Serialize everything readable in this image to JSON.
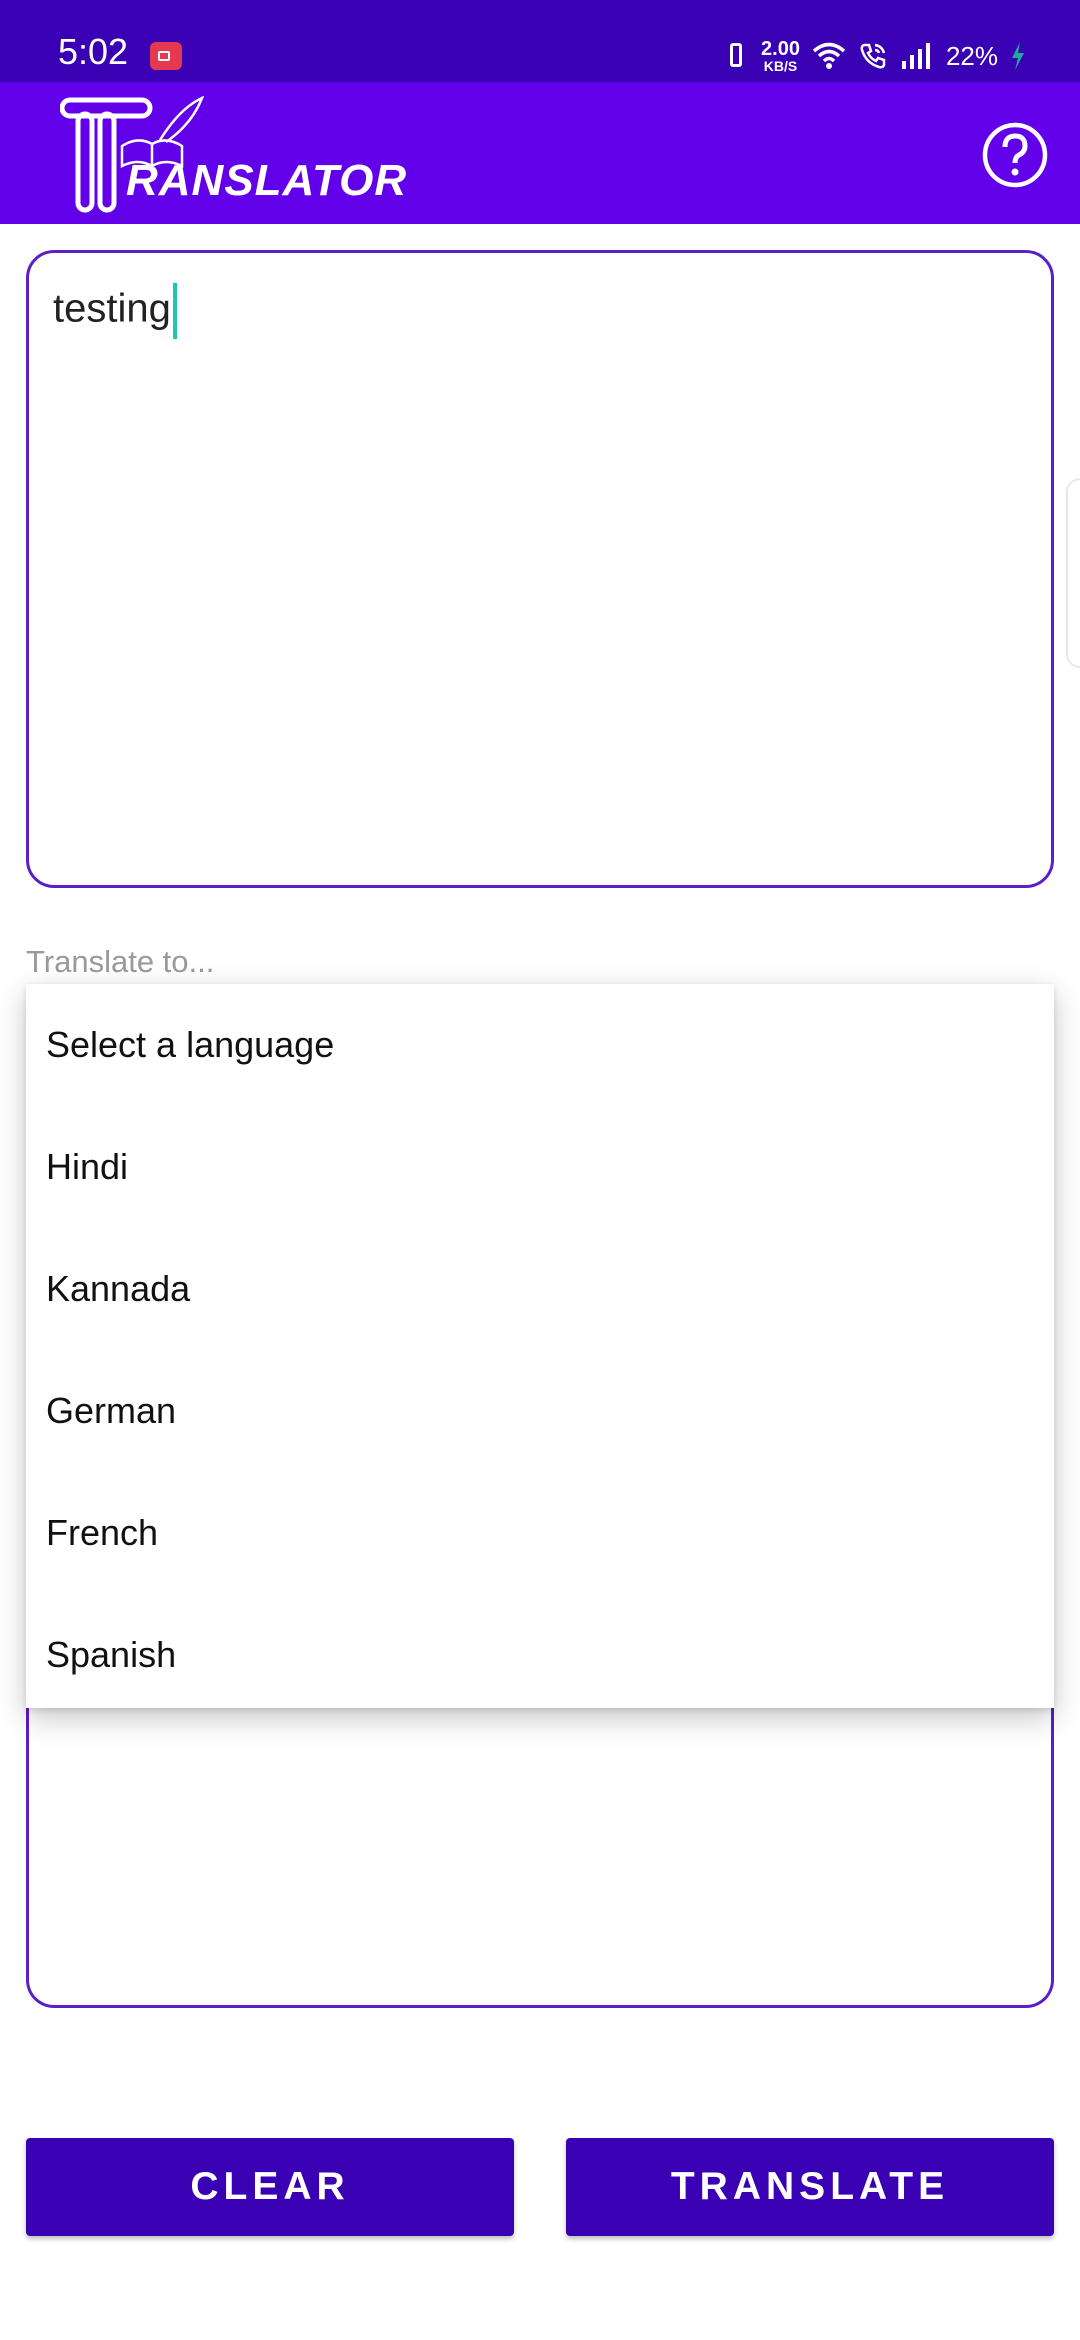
{
  "status_bar": {
    "time": "5:02",
    "net_speed_value": "2.00",
    "net_speed_unit": "KB/S",
    "battery": "22%",
    "icons": [
      "screen-record-icon",
      "vibrate-icon",
      "wifi-icon",
      "wifi-calling-icon",
      "signal-icon",
      "charging-icon"
    ]
  },
  "app_bar": {
    "logo_text": "RANSLATOR",
    "help_icon": "help-circle-icon"
  },
  "input": {
    "value": "testing"
  },
  "spinner": {
    "hint": "Translate to...",
    "options": [
      "Select a language",
      "Hindi",
      "Kannada",
      "German",
      "French",
      "Spanish"
    ]
  },
  "buttons": {
    "clear_label": "CLEAR",
    "translate_label": "TRANSLATE"
  },
  "colors": {
    "status_bar": "#3a00b4",
    "app_bar": "#6200ea",
    "button": "#3a00b4",
    "border": "#5b1ec7",
    "caret": "#19c8b8"
  }
}
